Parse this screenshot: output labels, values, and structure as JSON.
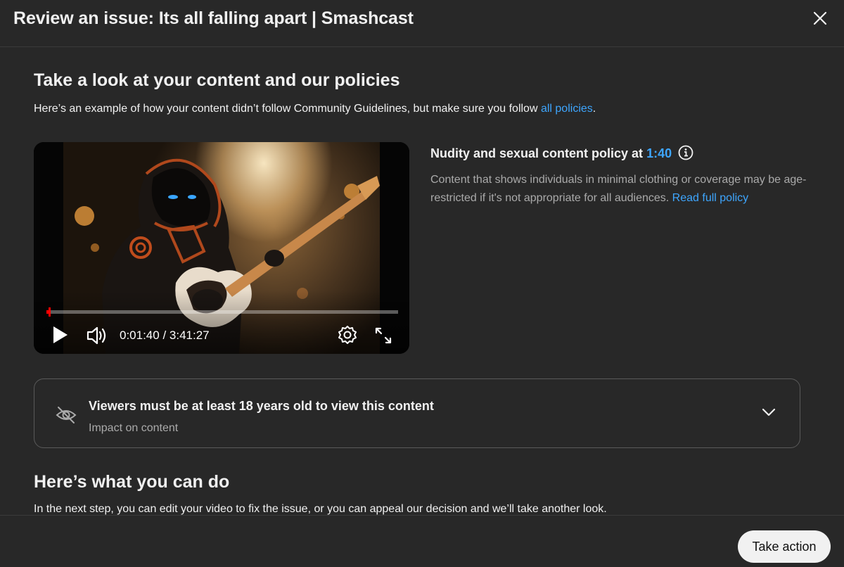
{
  "header": {
    "title": "Review an issue: Its all falling apart | Smashcast"
  },
  "content_section": {
    "title": "Take a look at your content and our policies",
    "description_prefix": "Here’s an example of how your content didn’t follow Community Guidelines, but make sure you follow ",
    "policies_link": "all policies",
    "description_suffix": "."
  },
  "player": {
    "time_display": "0:01:40 / 3:41:27",
    "progress_fraction": 0.008,
    "accent_color": "#ff0000",
    "icons": [
      "play-icon",
      "volume-icon",
      "settings-icon",
      "fullscreen-icon"
    ]
  },
  "policy": {
    "title_prefix": "Nudity and sexual content policy at ",
    "timestamp": "1:40",
    "description": "Content that shows individuals in minimal clothing or coverage may be age-restricted if it's not appropriate for all audiences. ",
    "read_link": "Read full policy"
  },
  "impact": {
    "title": "Viewers must be at least 18 years old to view this content",
    "subtitle": "Impact on content"
  },
  "actions_section": {
    "title": "Here’s what you can do",
    "description": "In the next step, you can edit your video to fix the issue, or you can appeal our decision and we’ll take another look."
  },
  "footer": {
    "take_action_label": "Take action"
  },
  "colors": {
    "link": "#3ea6ff",
    "background": "#282828",
    "button_bg": "#f1f1f1"
  }
}
